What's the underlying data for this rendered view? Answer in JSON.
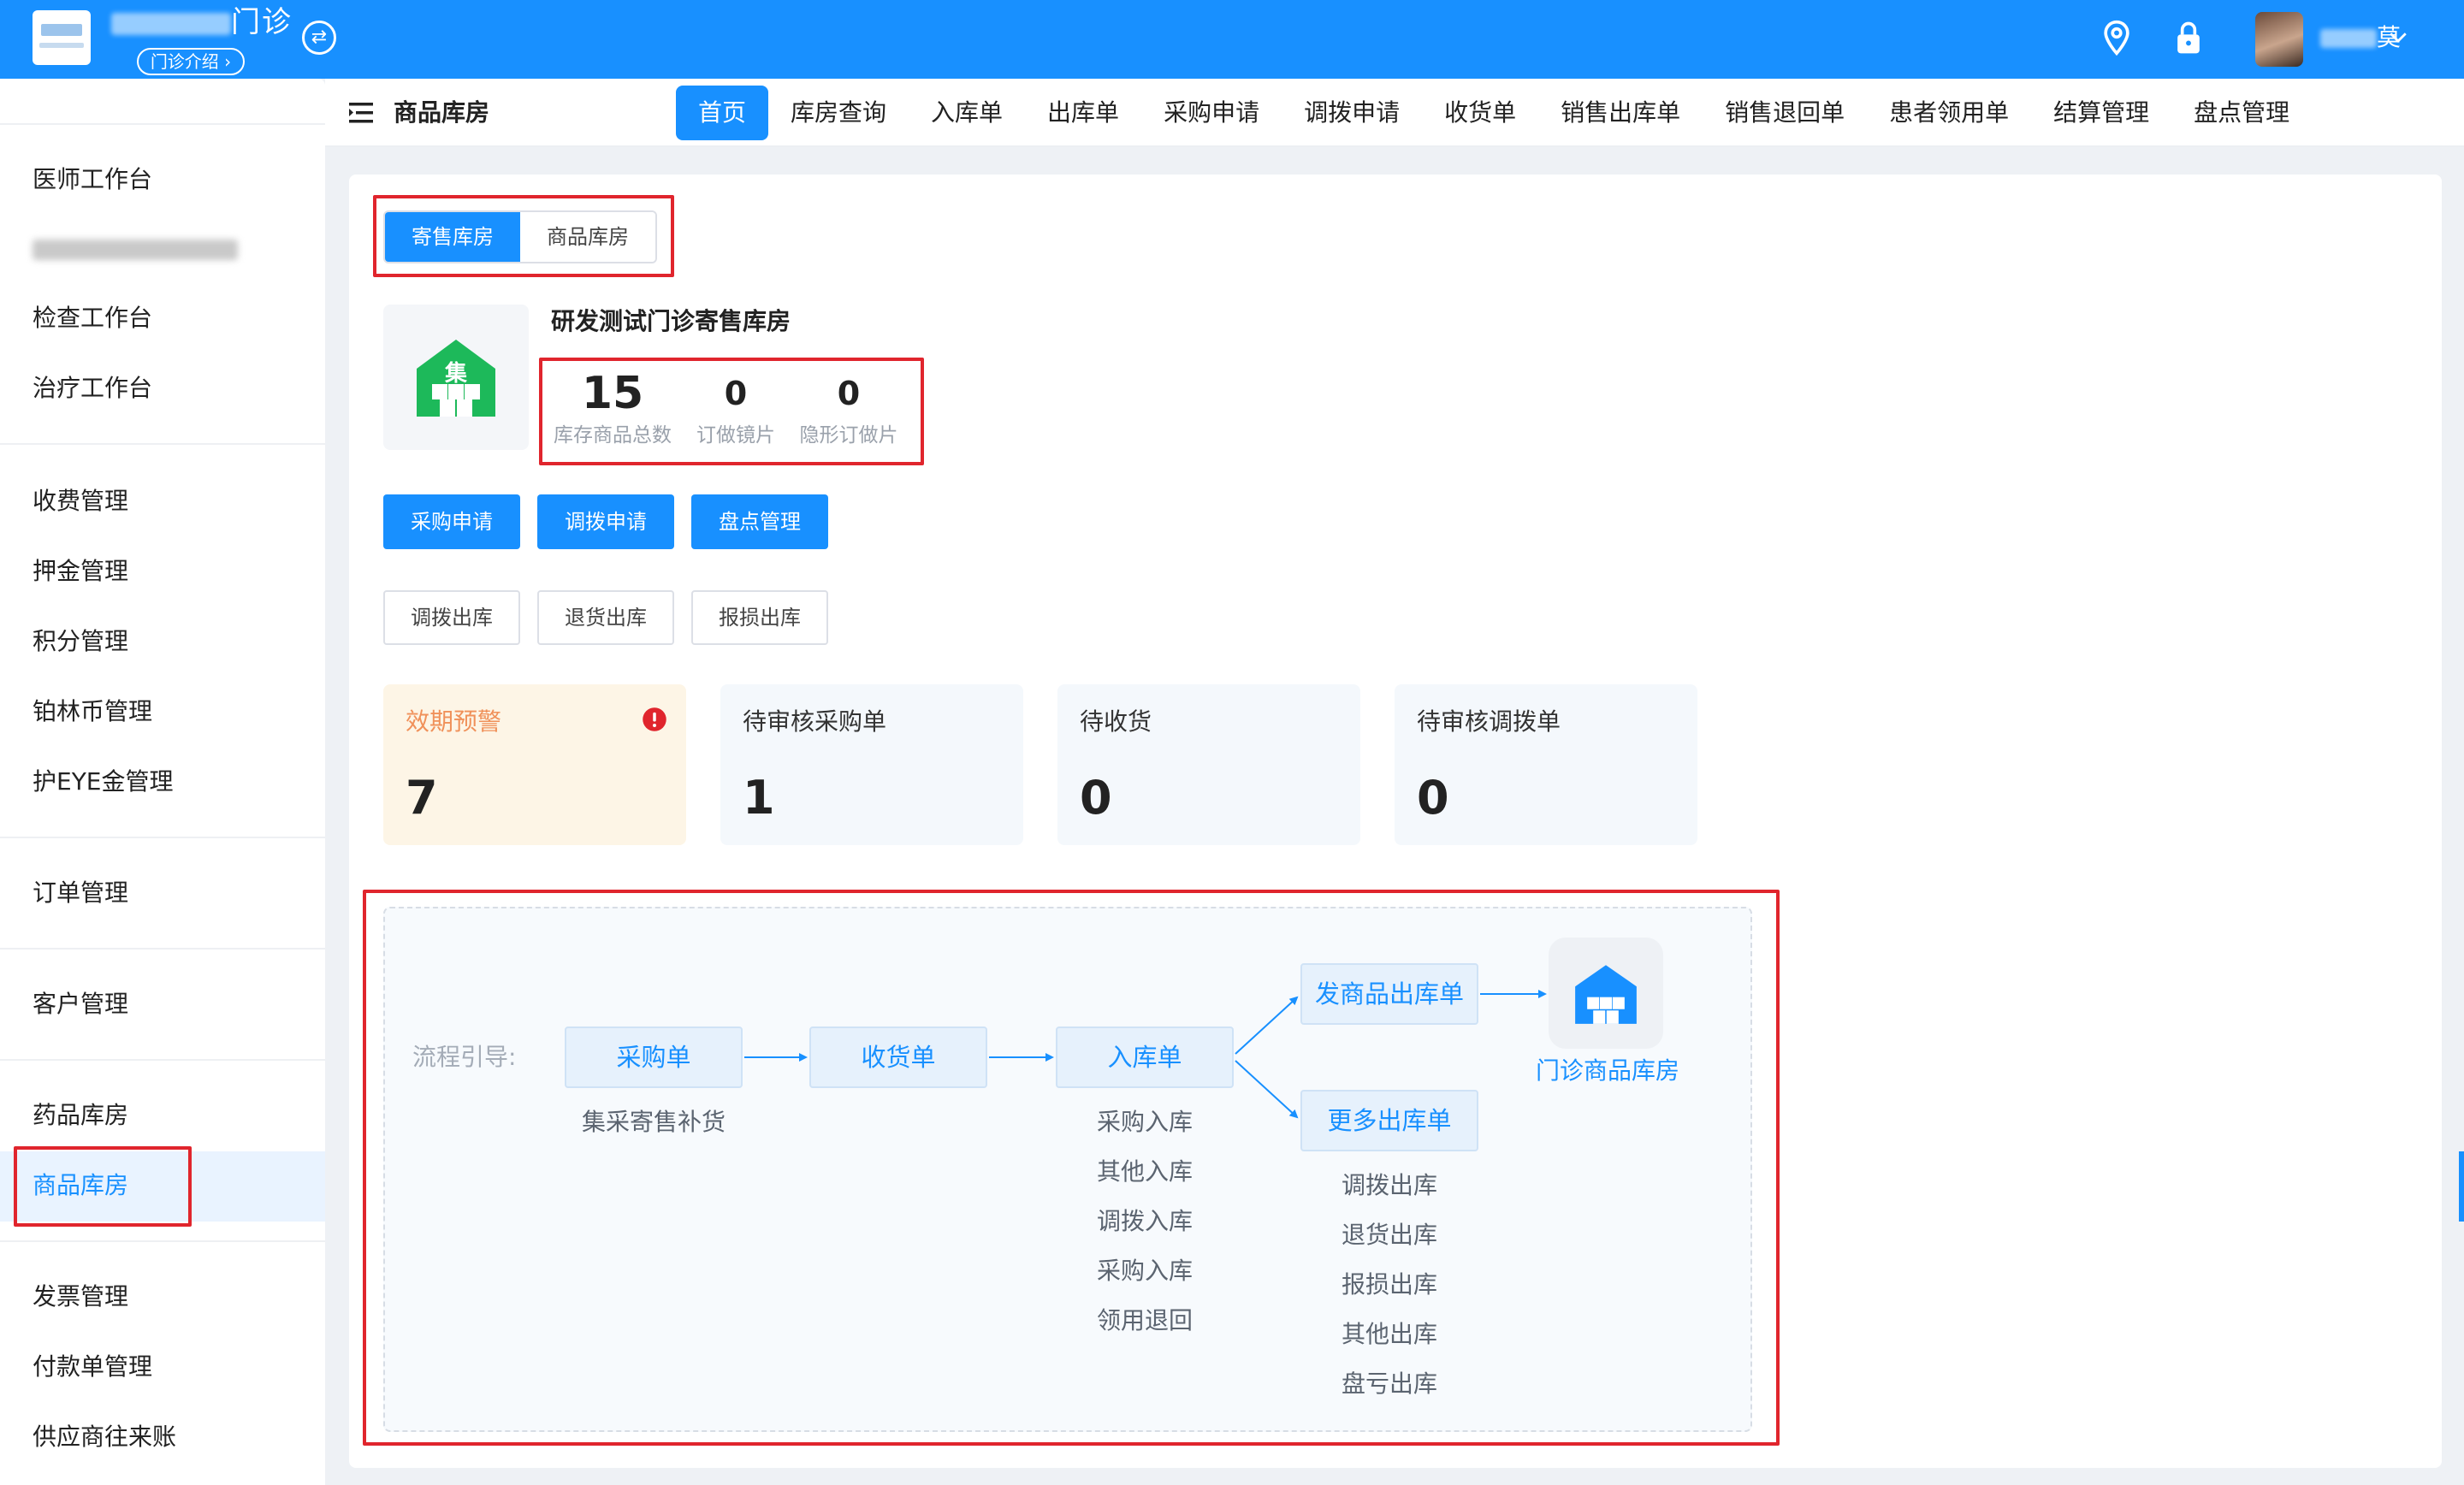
{
  "header": {
    "clinic_name_suffix": "门诊",
    "intro_label": "门诊介绍 ›",
    "user_suffix": "莫"
  },
  "sidebar": {
    "items": [
      {
        "label": "医师工作台"
      },
      {
        "label": "检查工作台"
      },
      {
        "label": "治疗工作台"
      },
      {
        "label": "收费管理"
      },
      {
        "label": "押金管理"
      },
      {
        "label": "积分管理"
      },
      {
        "label": "铂林币管理"
      },
      {
        "label": "护EYE金管理"
      },
      {
        "label": "订单管理"
      },
      {
        "label": "客户管理"
      },
      {
        "label": "药品库房"
      },
      {
        "label": "商品库房"
      },
      {
        "label": "发票管理"
      },
      {
        "label": "付款单管理"
      },
      {
        "label": "供应商往来账"
      }
    ]
  },
  "navbar": {
    "title": "商品库房",
    "tabs": [
      "首页",
      "库房查询",
      "入库单",
      "出库单",
      "采购申请",
      "调拨申请",
      "收货单",
      "销售出库单",
      "销售退回单",
      "患者领用单",
      "结算管理",
      "盘点管理"
    ]
  },
  "main": {
    "segments": [
      "寄售库房",
      "商品库房"
    ],
    "store_icon_char": "集",
    "store_name": "研发测试门诊寄售库房",
    "stats": [
      {
        "value": "15",
        "label": "库存商品总数"
      },
      {
        "value": "0",
        "label": "订做镜片"
      },
      {
        "value": "0",
        "label": "隐形订做片"
      }
    ],
    "primary_buttons": [
      "采购申请",
      "调拨申请",
      "盘点管理"
    ],
    "secondary_buttons": [
      "调拨出库",
      "退货出库",
      "报损出库"
    ],
    "kpis": [
      {
        "title": "效期预警",
        "value": "7"
      },
      {
        "title": "待审核采购单",
        "value": "1"
      },
      {
        "title": "待收货",
        "value": "0"
      },
      {
        "title": "待审核调拨单",
        "value": "0"
      }
    ]
  },
  "flow": {
    "label": "流程引导:",
    "purchase": {
      "title": "采购单",
      "subs": [
        "集采寄售补货"
      ]
    },
    "receive": {
      "title": "收货单"
    },
    "inbound": {
      "title": "入库单",
      "subs": [
        "采购入库",
        "其他入库",
        "调拨入库",
        "采购入库",
        "领用退回"
      ]
    },
    "ship_out": {
      "title": "发商品出库单"
    },
    "more_out": {
      "title": "更多出库单",
      "subs": [
        "调拨出库",
        "退货出库",
        "报损出库",
        "其他出库",
        "盘亏出库"
      ]
    },
    "warehouse": {
      "label": "门诊商品库房"
    }
  },
  "colors": {
    "primary": "#1890ff",
    "warning_bg": "#fdf5e6",
    "warning_text": "#f0915a",
    "alert": "#e0252d",
    "store_green": "#1db95a"
  }
}
